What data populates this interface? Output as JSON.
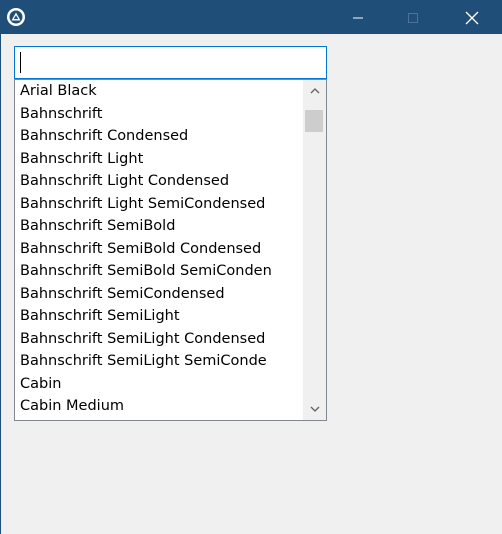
{
  "window": {
    "title": "",
    "controls": {
      "minimize": "minimize",
      "maximize": "maximize",
      "close": "close"
    }
  },
  "search": {
    "value": "",
    "placeholder": ""
  },
  "font_list": {
    "items": [
      "Arial Black",
      "Bahnschrift",
      "Bahnschrift Condensed",
      "Bahnschrift Light",
      "Bahnschrift Light Condensed",
      "Bahnschrift Light SemiCondensed",
      "Bahnschrift SemiBold",
      "Bahnschrift SemiBold Condensed",
      "Bahnschrift SemiBold SemiConden",
      "Bahnschrift SemiCondensed",
      "Bahnschrift SemiLight",
      "Bahnschrift SemiLight Condensed",
      "Bahnschrift SemiLight SemiConde",
      "Cabin",
      "Cabin Medium"
    ]
  },
  "colors": {
    "titlebar": "#1f4e79",
    "focus_border": "#0078d7",
    "client_bg": "#f0f0f0"
  },
  "icons": {
    "app": "app-logo-icon",
    "scroll_up": "chevron-up-icon",
    "scroll_down": "chevron-down-icon"
  }
}
